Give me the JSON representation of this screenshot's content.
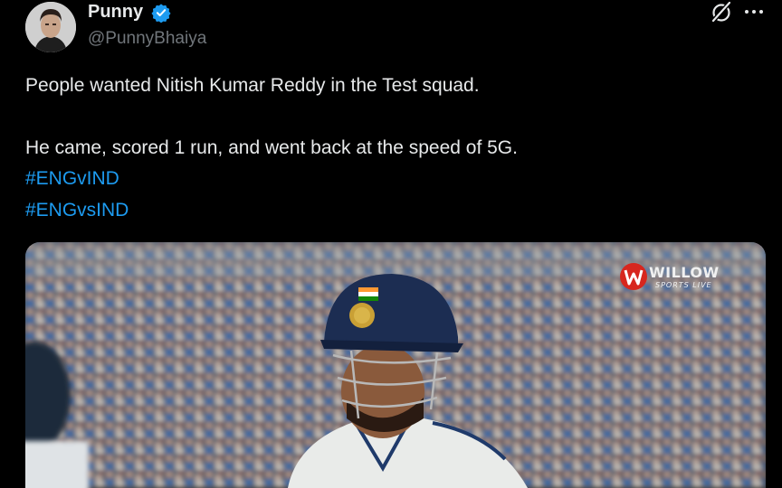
{
  "author": {
    "display_name": "Punny",
    "handle": "@PunnyBhaiya"
  },
  "tweet": {
    "line1": "People wanted Nitish Kumar Reddy in the Test squad.",
    "line2": "He came, scored 1 run, and went back at the speed of 5G.",
    "hashtags": [
      "#ENGvIND",
      "#ENGvsIND"
    ]
  },
  "media": {
    "broadcaster_logo": {
      "brand": "WILLOW",
      "sub": "SPORTS LIVE"
    }
  },
  "icons": {
    "verified": "verified-badge-icon",
    "grok": "grok-icon",
    "more": "more-icon"
  },
  "colors": {
    "background": "#000000",
    "text": "#e7e9ea",
    "muted": "#71767b",
    "link": "#1d9bf0",
    "verified": "#1d9bf0",
    "logo_red": "#d7261e"
  }
}
